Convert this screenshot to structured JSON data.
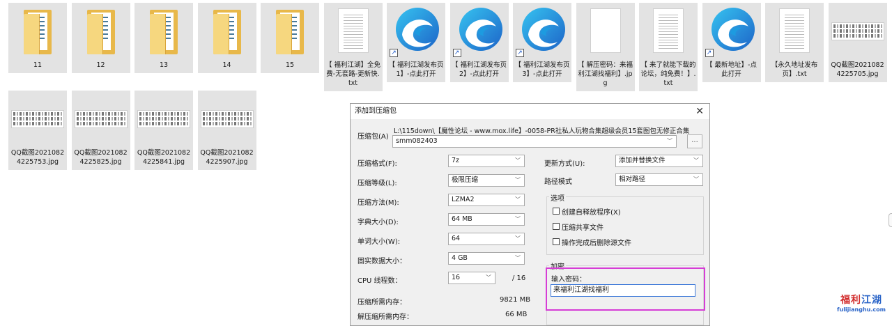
{
  "files_row1": [
    {
      "label": "11",
      "kind": "folder"
    },
    {
      "label": "12",
      "kind": "folder"
    },
    {
      "label": "13",
      "kind": "folder"
    },
    {
      "label": "14",
      "kind": "folder"
    },
    {
      "label": "15",
      "kind": "folder"
    },
    {
      "label": "【 福利江湖】全免费-无套路-更新快.txt",
      "kind": "text"
    },
    {
      "label": "【 福利江湖发布页1】-点此打开",
      "kind": "edge-shortcut"
    },
    {
      "label": "【 福利江湖发布页2】-点此打开",
      "kind": "edge-shortcut"
    },
    {
      "label": "【 福利江湖发布页3】-点此打开",
      "kind": "edge-shortcut"
    },
    {
      "label": "【 解压密码：来福利江湖找福利】.jpg",
      "kind": "blank"
    },
    {
      "label": "【 来了就能下载的论坛，纯免费！】.txt",
      "kind": "text"
    },
    {
      "label": "【 最新地址】-点此打开",
      "kind": "edge-shortcut"
    },
    {
      "label": "【永久地址发布页】.txt",
      "kind": "text"
    },
    {
      "label": "QQ截图20210824225705.jpg",
      "kind": "image"
    }
  ],
  "files_row2": [
    {
      "label": "QQ截图20210824225753.jpg",
      "kind": "image"
    },
    {
      "label": "QQ截图20210824225825.jpg",
      "kind": "image"
    },
    {
      "label": "QQ截图20210824225841.jpg",
      "kind": "image"
    },
    {
      "label": "QQ截图20210824225907.jpg",
      "kind": "image"
    }
  ],
  "dialog": {
    "title": "添加到压缩包",
    "close": "✕",
    "archive_label": "压缩包(A)",
    "archive_path": "L:\\115down\\【魔性论坛 - www.mox.life】-0058-PR社私人玩物合集超级会员15套图包无修正合集",
    "archive_name": "smm082403",
    "browse": "...",
    "format_label": "压缩格式(F):",
    "format_value": "7z",
    "level_label": "压缩等级(L):",
    "level_value": "极限压缩",
    "method_label": "压缩方法(M):",
    "method_value": "LZMA2",
    "dict_label": "字典大小(D):",
    "dict_value": "64 MB",
    "word_label": "单词大小(W):",
    "word_value": "64",
    "solid_label": "固实数据大小：",
    "solid_value": "4 GB",
    "cpu_label": "CPU 线程数：",
    "cpu_value": "16",
    "cpu_total": "/ 16",
    "mem_comp_label": "压缩所需内存：",
    "mem_comp_value": "9821 MB",
    "mem_decomp_label": "解压缩所需内存：",
    "mem_decomp_value": "66 MB",
    "update_label": "更新方式(U):",
    "update_value": "添加并替换文件",
    "path_label": "路径模式",
    "path_value": "相对路径",
    "options_title": "选项",
    "opt_sfx": "创建自释放程序(X)",
    "opt_shared": "压缩共享文件",
    "opt_delete": "操作完成后删除源文件",
    "encrypt_title": "加密",
    "password_label": "输入密码：",
    "password_value": "来福利江湖找福利"
  },
  "watermark": {
    "text1": "福利",
    "text2": "江湖",
    "url": "fulijianghu.com"
  }
}
